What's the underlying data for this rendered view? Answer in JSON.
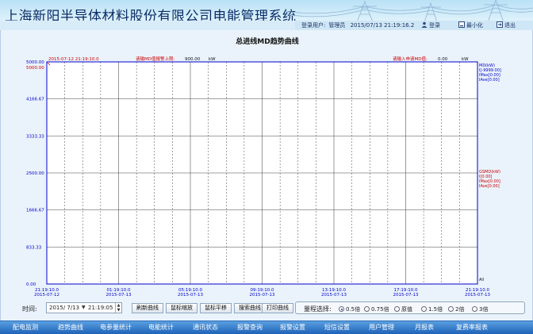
{
  "header": {
    "title": "上海新阳半导体材料股份有限公司电能管理系统",
    "login_label": "登录用户:",
    "user": "管理员",
    "datetime": "2015/07/13  21:19:16.2",
    "btn_login": "登录",
    "btn_minimize": "最小化",
    "btn_exit": "退出"
  },
  "chart_title": "总进线MD趋势曲线",
  "chart_data": {
    "type": "line",
    "title": "总进线MD趋势曲线",
    "start_label": "2015-07-12 21:19:10.0",
    "alarm_label": "请输MD值报警上限:",
    "alarm_value": "900.00",
    "alarm_unit": "kW",
    "request_label": "请输入申请MD值:",
    "request_value": "0.00",
    "request_unit": "kW",
    "ylim": [
      0,
      5000
    ],
    "yticks": [
      "5000.00",
      "4166.67",
      "3333.33",
      "2500.00",
      "1666.67",
      "833.33",
      "0.00"
    ],
    "ymax_red": "5000.00",
    "xtick_times": [
      "21:19:10.0",
      "01:19:10.0",
      "05:19:10.0",
      "09:19:10.0",
      "13:19:10.0",
      "17:19:10.0",
      "21:19:10.0"
    ],
    "xtick_dates": [
      "2015-07-12",
      "2015-07-13",
      "2015-07-13",
      "2015-07-13",
      "2015-07-13",
      "2015-07-13",
      "2015-07-13"
    ],
    "legend_top": [
      "MD(kW)",
      "I[-9999.00]",
      "IMax[0.00]",
      "IAve[0.00]"
    ],
    "legend_mid": [
      "GSMD(kW)",
      "I[0.00]",
      "IMax[0.00]",
      "IAve[0.00]"
    ],
    "bottom_right": "All",
    "series": []
  },
  "controls": {
    "time_label": "时间:",
    "date_value": "2015/ 7/13",
    "time_value": "21:19:05",
    "buttons": [
      "刷新曲线",
      "鼠标缩放",
      "鼠标平移",
      "搜索曲线",
      "打印曲线"
    ],
    "range_label": "量程选择:",
    "range_options": [
      "0.5倍",
      "0.75倍",
      "原值",
      "1.5倍",
      "2倍",
      "3倍"
    ],
    "range_selected": 0
  },
  "nav": [
    "配电监测",
    "趋势曲线",
    "电参量统计",
    "电能统计",
    "通讯状态",
    "报警查询",
    "报警设置",
    "短信设置",
    "用户管理",
    "月报表",
    "复费率报表"
  ],
  "colors": {
    "header_text": "#0b2c66",
    "axis_blue": "#0000cc",
    "alarm_red": "#cc0000",
    "grid_solid": "#333333",
    "nav_bg": "#2a72c6"
  }
}
